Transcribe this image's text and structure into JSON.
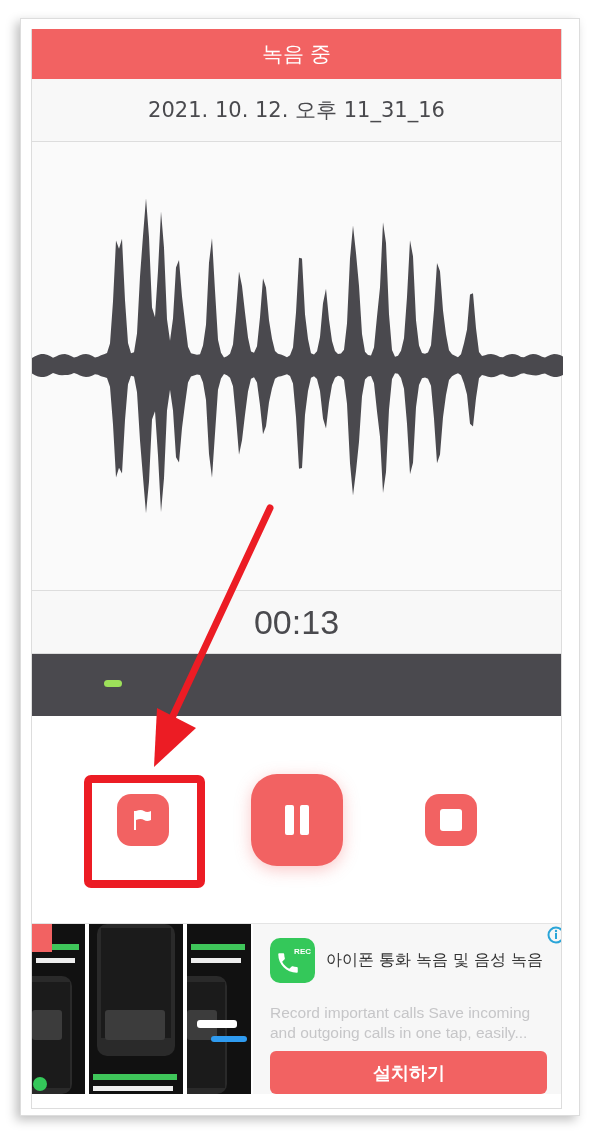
{
  "header": {
    "title": "녹음 중"
  },
  "recording": {
    "name": "2021. 10. 12. 오후 11_31_16",
    "elapsed": "00:13",
    "level": 0.14
  },
  "controls": [
    {
      "kind": "flag",
      "highlighted": true
    },
    {
      "kind": "pause",
      "highlighted": false
    },
    {
      "kind": "stop",
      "highlighted": false
    }
  ],
  "ad": {
    "icon_label": "REC",
    "title": "아이폰 통화 녹음 및 음성 녹음",
    "description": "Record important calls Save incoming and outgoing calls in one tap, easily...",
    "button": "설치하기"
  }
}
